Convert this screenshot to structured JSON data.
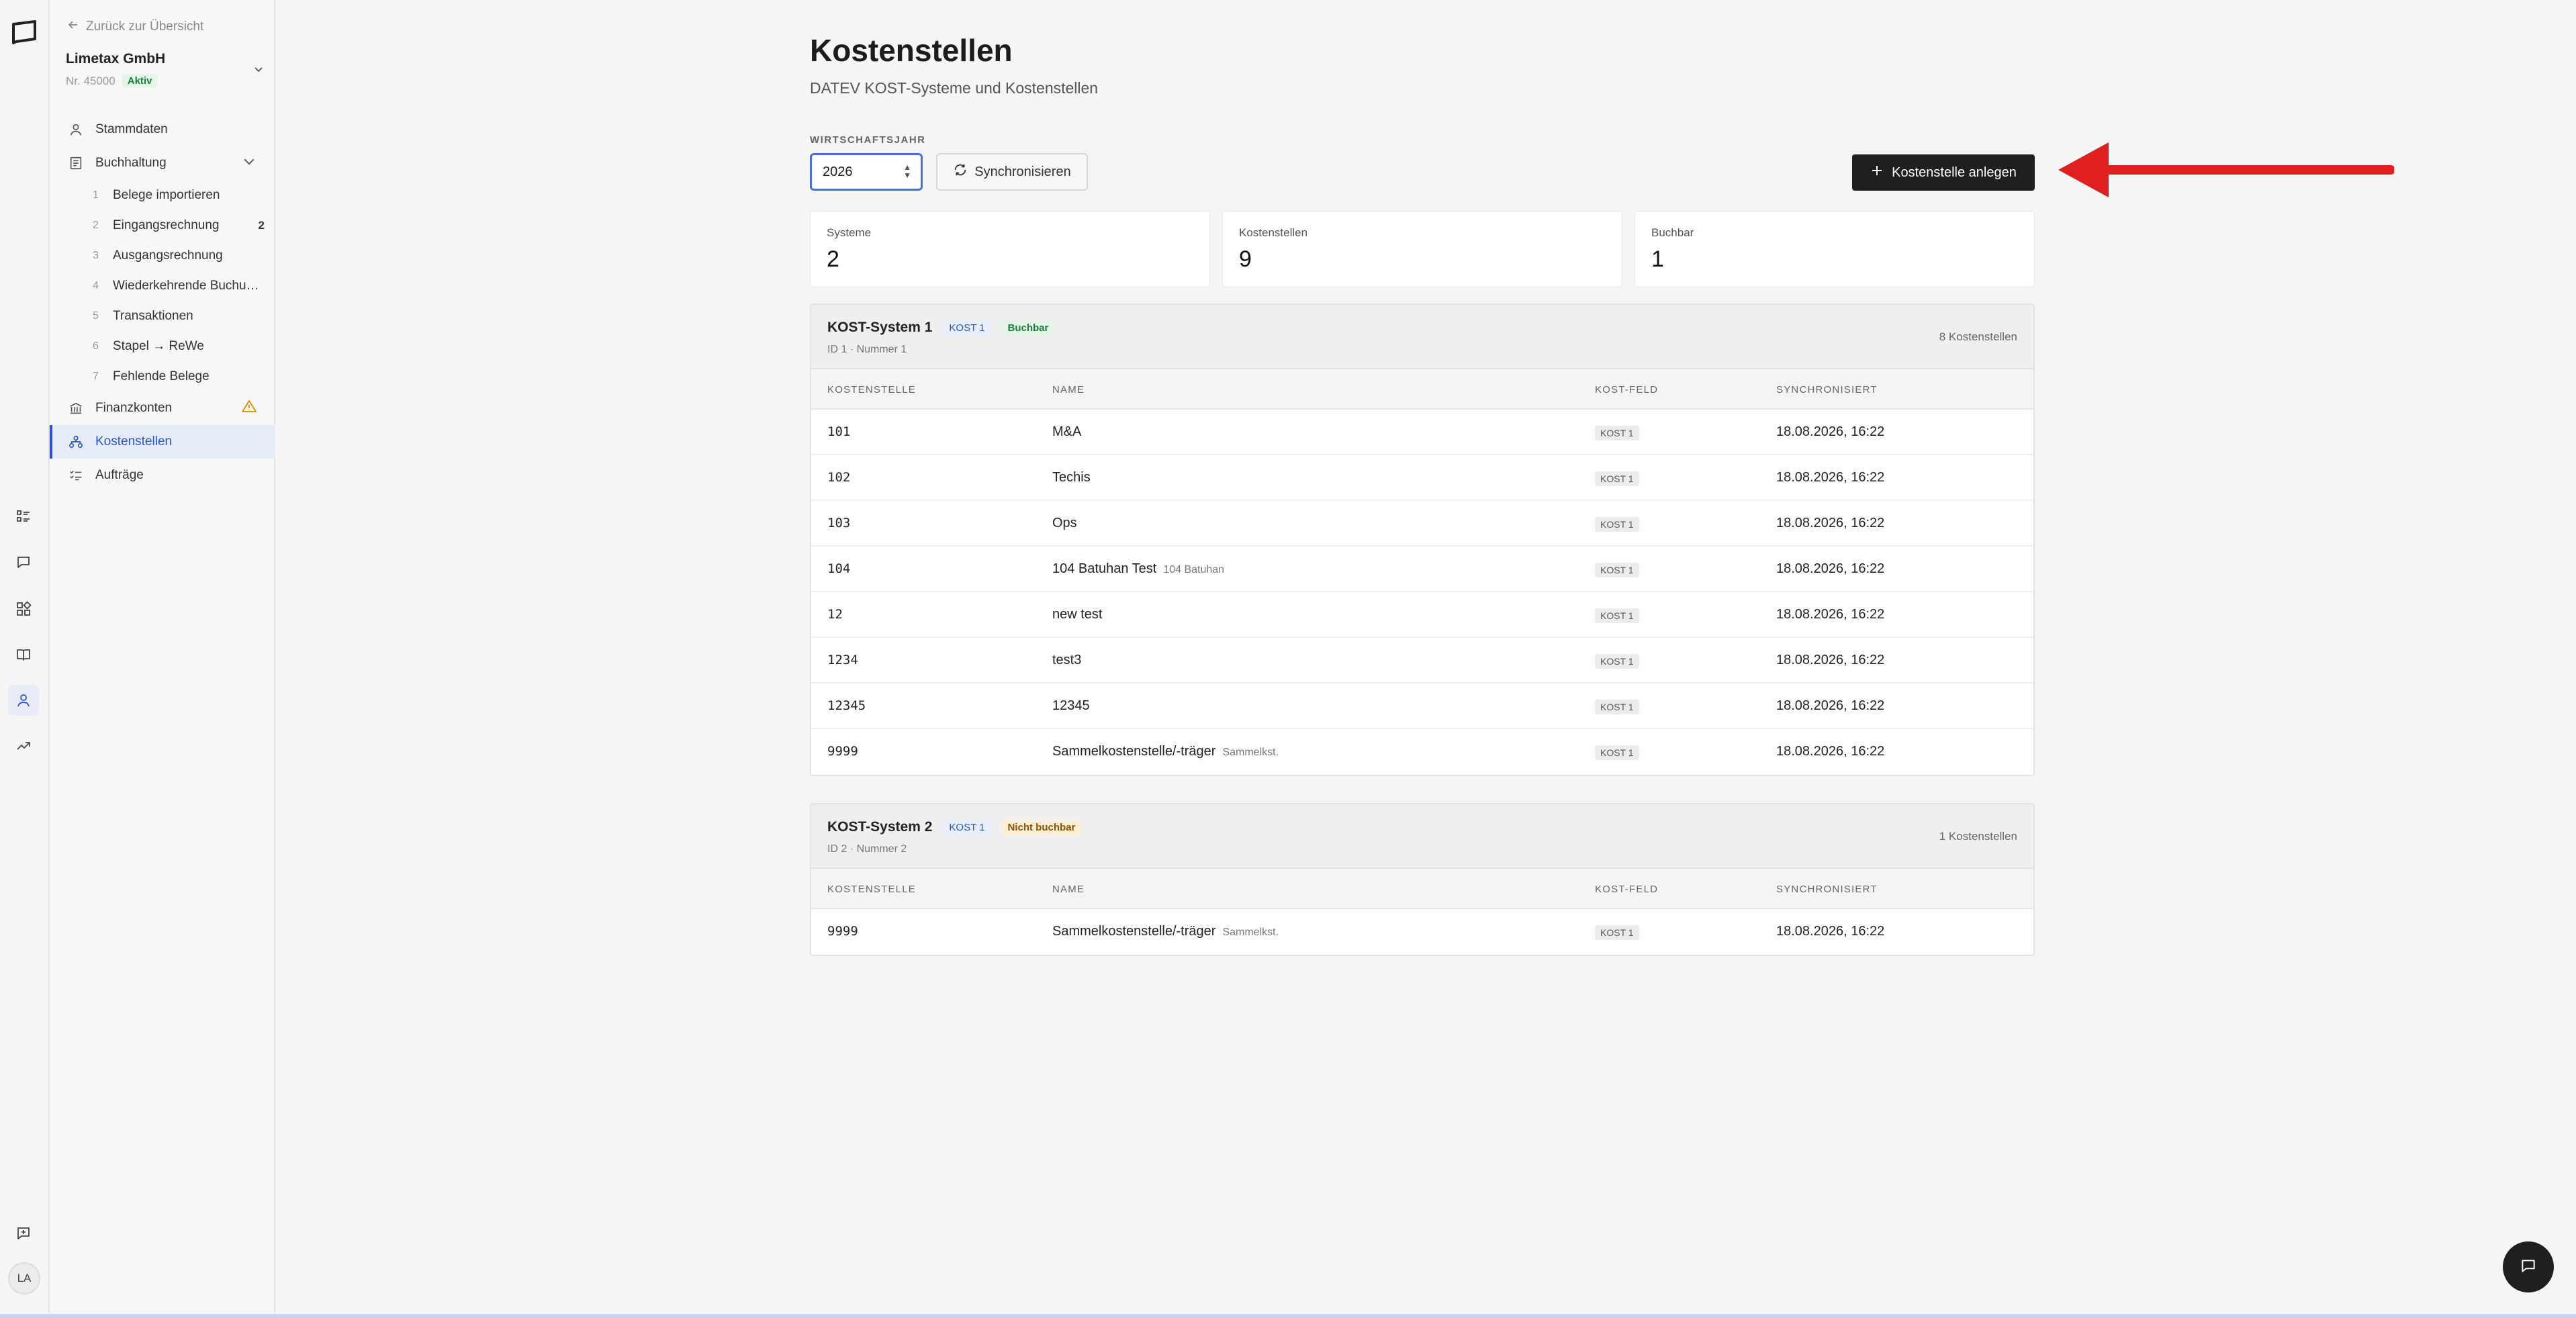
{
  "sidebar": {
    "back_label": "Zurück zur Übersicht",
    "company": {
      "name": "Limetax GmbH",
      "number": "Nr. 45000",
      "status": "Aktiv"
    },
    "nav": {
      "stammdaten": "Stammdaten",
      "buchhaltung": "Buchhaltung",
      "finanzkonten": "Finanzkonten",
      "kostenstellen": "Kostenstellen",
      "auftraege": "Aufträge"
    },
    "buchhaltung_items": [
      {
        "num": "1",
        "label": "Belege importieren"
      },
      {
        "num": "2",
        "label": "Eingangsrechnung",
        "count": "2"
      },
      {
        "num": "3",
        "label": "Ausgangsrechnung"
      },
      {
        "num": "4",
        "label": "Wiederkehrende Buchungen"
      },
      {
        "num": "5",
        "label": "Transaktionen"
      },
      {
        "num": "6",
        "label": "Stapel → ReWe"
      },
      {
        "num": "7",
        "label": "Fehlende Belege"
      }
    ]
  },
  "rail": {
    "avatar": "LA"
  },
  "page": {
    "title": "Kostenstellen",
    "subtitle": "DATEV KOST-Systeme und Kostenstellen",
    "year_label": "WIRTSCHAFTSJAHR",
    "year_value": "2026",
    "sync_label": "Synchronisieren",
    "create_label": "Kostenstelle anlegen"
  },
  "stats": [
    {
      "label": "Systeme",
      "value": "2"
    },
    {
      "label": "Kostenstellen",
      "value": "9"
    },
    {
      "label": "Buchbar",
      "value": "1"
    }
  ],
  "columns": [
    "KOSTENSTELLE",
    "NAME",
    "KOST-FELD",
    "SYNCHRONISIERT"
  ],
  "systems": [
    {
      "name": "KOST-System 1",
      "field": "KOST 1",
      "status": "Buchbar",
      "meta": "ID 1 · Nummer 1",
      "count": "8 Kostenstellen",
      "rows": [
        {
          "code": "101",
          "name": "M&A",
          "sub": "",
          "field": "KOST 1",
          "synced": "18.08.2026, 16:22"
        },
        {
          "code": "102",
          "name": "Techis",
          "sub": "",
          "field": "KOST 1",
          "synced": "18.08.2026, 16:22"
        },
        {
          "code": "103",
          "name": "Ops",
          "sub": "",
          "field": "KOST 1",
          "synced": "18.08.2026, 16:22"
        },
        {
          "code": "104",
          "name": "104 Batuhan Test",
          "sub": "104 Batuhan",
          "field": "KOST 1",
          "synced": "18.08.2026, 16:22"
        },
        {
          "code": "12",
          "name": "new test",
          "sub": "",
          "field": "KOST 1",
          "synced": "18.08.2026, 16:22"
        },
        {
          "code": "1234",
          "name": "test3",
          "sub": "",
          "field": "KOST 1",
          "synced": "18.08.2026, 16:22"
        },
        {
          "code": "12345",
          "name": "12345",
          "sub": "",
          "field": "KOST 1",
          "synced": "18.08.2026, 16:22"
        },
        {
          "code": "9999",
          "name": "Sammelkostenstelle/-träger",
          "sub": "Sammelkst.",
          "field": "KOST 1",
          "synced": "18.08.2026, 16:22"
        }
      ]
    },
    {
      "name": "KOST-System 2",
      "field": "KOST 1",
      "status": "Nicht buchbar",
      "meta": "ID 2 · Nummer 2",
      "count": "1 Kostenstellen",
      "rows": [
        {
          "code": "9999",
          "name": "Sammelkostenstelle/-träger",
          "sub": "Sammelkst.",
          "field": "KOST 1",
          "synced": "18.08.2026, 16:22"
        }
      ]
    }
  ],
  "colors": {
    "accent": "#2d55c9",
    "arrow": "#e02020",
    "dark_button": "#1f1f1f"
  }
}
